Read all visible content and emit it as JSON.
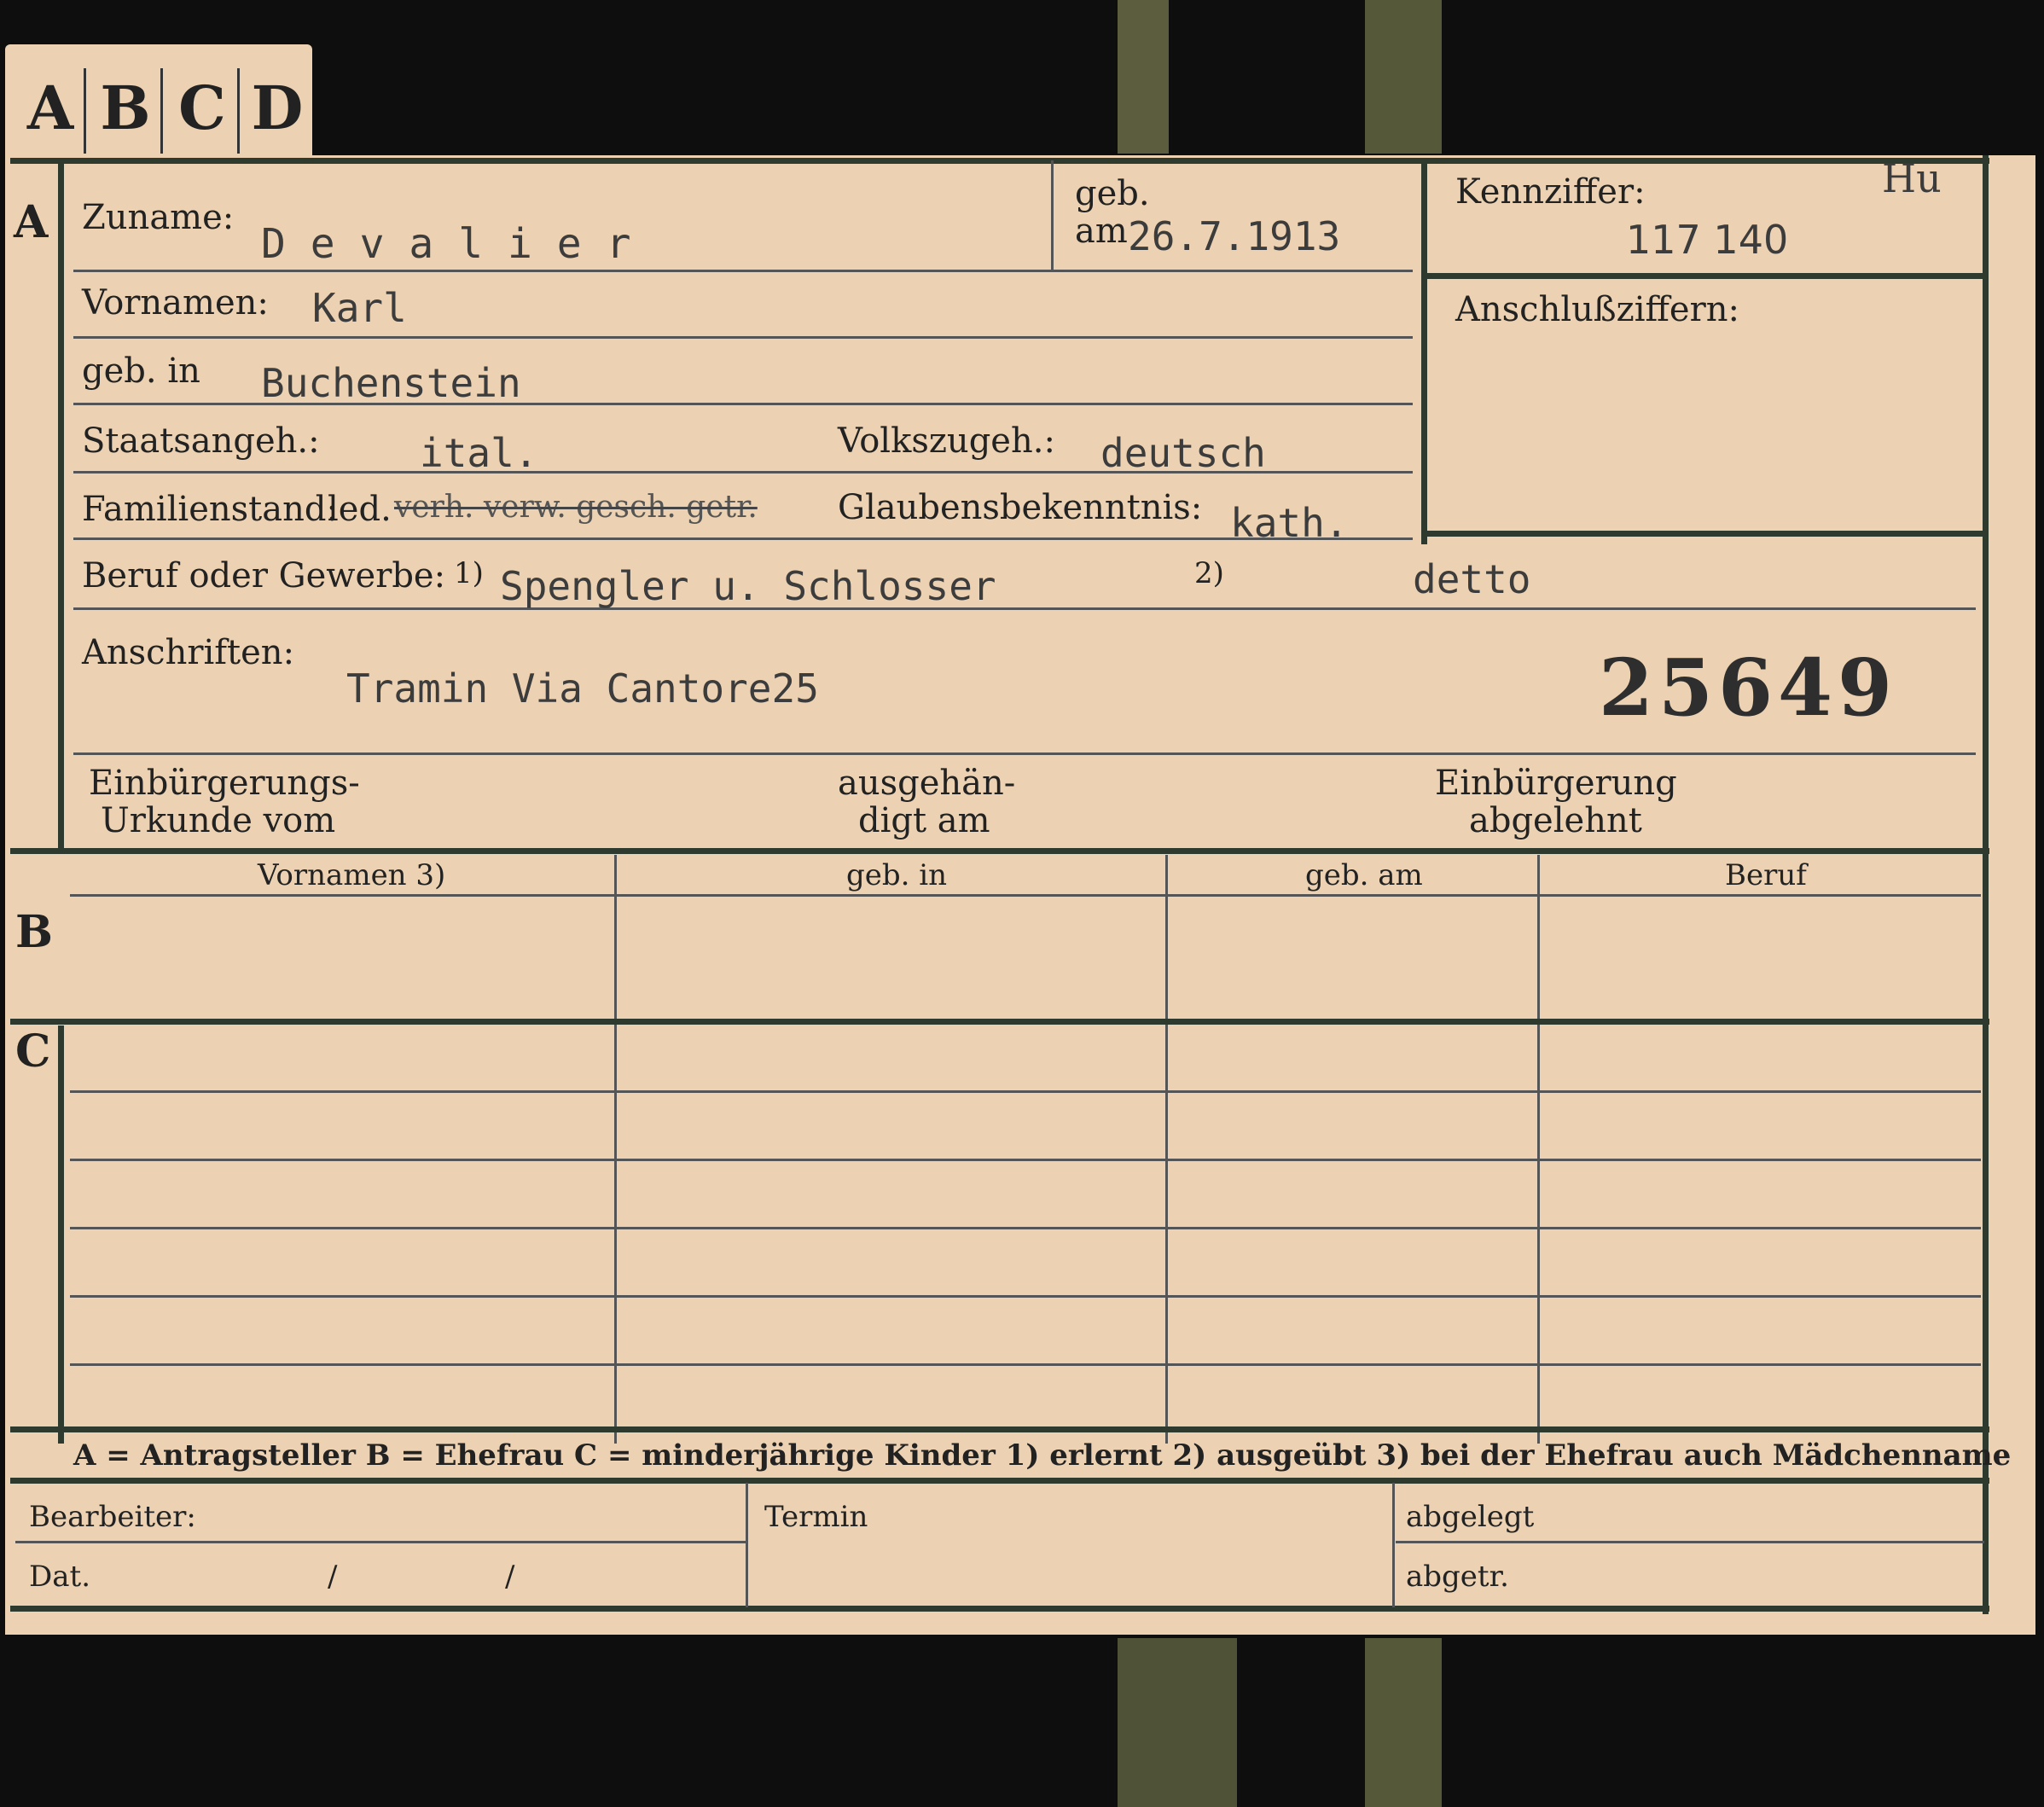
{
  "tabs": [
    "A",
    "B",
    "C",
    "D"
  ],
  "sections": {
    "a": "A",
    "b": "B",
    "c": "C"
  },
  "header": {
    "surname_label": "Zuname:",
    "surname": "D e v a l i e r",
    "born_label": "geb.",
    "born_on_label": "am",
    "born_on": "26.7.1913",
    "kennziffer_label": "Kennziffer:",
    "kennziffer": "117 140",
    "kennziffer_note": "Hu",
    "anschluss_label": "Anschlußziffern:"
  },
  "person": {
    "firstname_label": "Vornamen:",
    "firstname": "Karl",
    "birthplace_label": "geb. in",
    "birthplace": "Buchenstein",
    "citizenship_label": "Staatsangeh.:",
    "citizenship": "ital.",
    "ethnicity_label": "Volkszugeh.:",
    "ethnicity": "deutsch",
    "family_label": "Familienstand:",
    "family_value": "led.",
    "family_struck": "verh. verw. gesch. getr.",
    "religion_label": "Glaubensbekenntnis:",
    "religion": "kath.",
    "profession_label": "Beruf oder Gewerbe:",
    "mark1": "1)",
    "profession1": "Spengler u. Schlosser",
    "mark2": "2)",
    "profession2": "detto",
    "address_label": "Anschriften:",
    "address": "Tramin Via Cantore25",
    "stamp_number": "25649",
    "naturalization_label_1": "Einbürgerungs-",
    "naturalization_label_2": "Urkunde vom",
    "issued_label_1": "ausgehän-",
    "issued_label_2": "digt am",
    "rejected_label_1": "Einbürgerung",
    "rejected_label_2": "abgelehnt"
  },
  "table": {
    "columns": [
      "Vornamen 3)",
      "geb. in",
      "geb. am",
      "Beruf"
    ]
  },
  "legend": "A = Antragsteller   B = Ehefrau   C = minderjährige Kinder   1) erlernt   2) ausgeübt   3) bei der Ehefrau auch Mädchenname",
  "footer": {
    "clerk_label": "Bearbeiter:",
    "date_label": "Dat.",
    "slash": "/",
    "term_label": "Termin",
    "filed_label": "abgelegt",
    "sent_label": "abgetr."
  },
  "colors": {
    "card": "#ecd2b2",
    "ink": "#222222",
    "background": "#0e0e0e",
    "border": "#2f3a2e"
  }
}
